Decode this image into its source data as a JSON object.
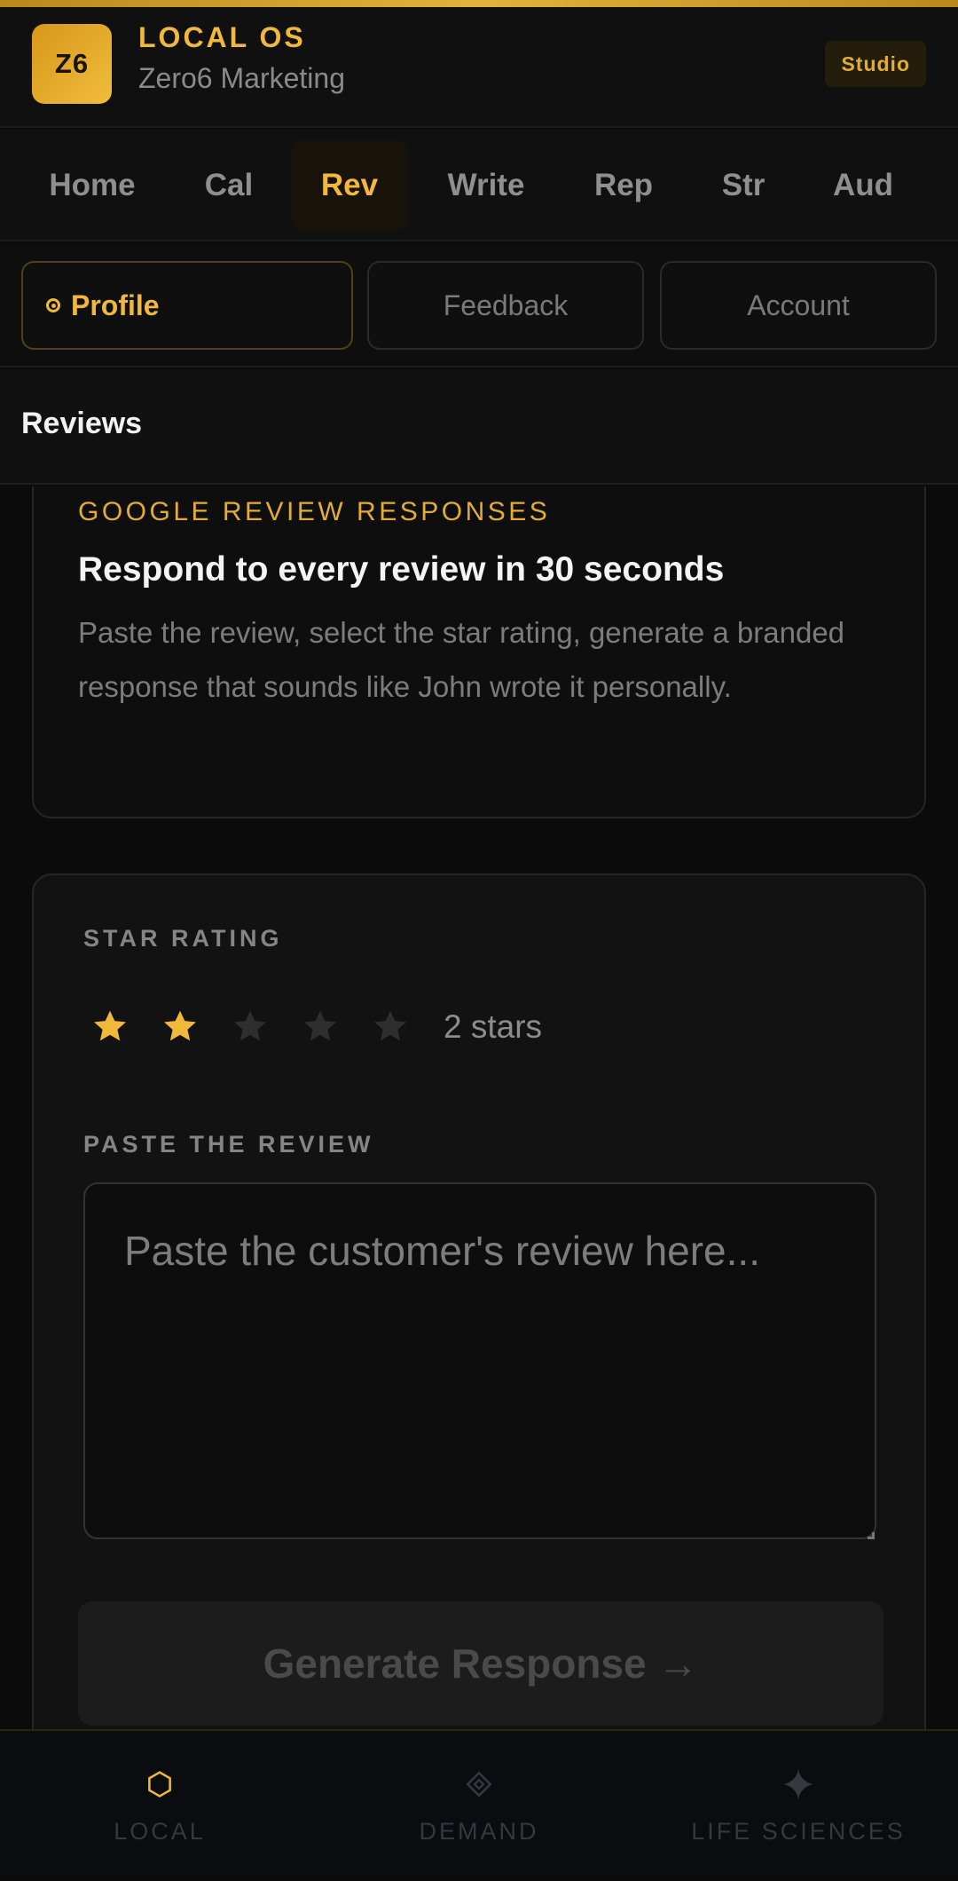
{
  "header": {
    "logo_text": "Z6",
    "title": "LOCAL OS",
    "subtitle": "Zero6 Marketing",
    "badge": "Studio"
  },
  "nav": {
    "items": [
      {
        "label": "Home",
        "active": false
      },
      {
        "label": "Cal",
        "active": false
      },
      {
        "label": "Rev",
        "active": true
      },
      {
        "label": "Write",
        "active": false
      },
      {
        "label": "Rep",
        "active": false
      },
      {
        "label": "Str",
        "active": false
      },
      {
        "label": "Aud",
        "active": false
      }
    ]
  },
  "tabs": [
    {
      "label": "Profile",
      "active": true
    },
    {
      "label": "Feedback",
      "active": false
    },
    {
      "label": "Account",
      "active": false
    }
  ],
  "section": {
    "title": "Reviews"
  },
  "intro": {
    "eyebrow": "GOOGLE REVIEW RESPONSES",
    "title": "Respond to every review in 30 seconds",
    "body": "Paste the review, select the star rating, generate a branded response that sounds like John wrote it personally."
  },
  "form": {
    "star_label": "STAR RATING",
    "rating": 2,
    "max_rating": 5,
    "rating_text": "2 stars",
    "review_label": "PASTE THE REVIEW",
    "review_placeholder": "Paste the customer's review here...",
    "review_value": "",
    "generate_label": "Generate Response →"
  },
  "bottom_nav": [
    {
      "label": "LOCAL",
      "icon": "hexagon-icon",
      "active": true
    },
    {
      "label": "DEMAND",
      "icon": "diamond-icon",
      "active": false
    },
    {
      "label": "LIFE SCIENCES",
      "icon": "sparkle-icon",
      "active": false
    }
  ],
  "colors": {
    "accent": "#f1b93a",
    "background": "#0b0b0b",
    "star_empty": "#2e2e2e"
  }
}
